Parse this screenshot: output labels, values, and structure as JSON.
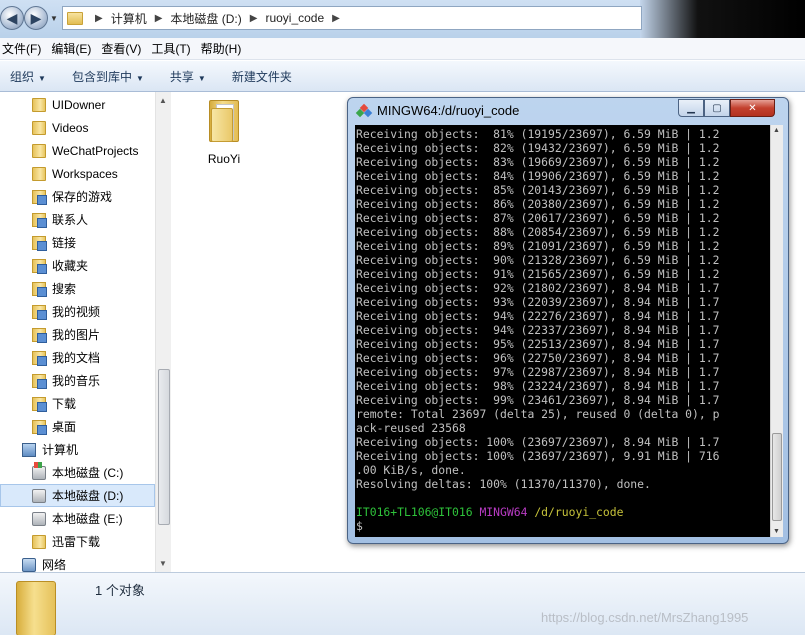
{
  "address": {
    "crumbs": [
      "计算机",
      "本地磁盘 (D:)",
      "ruoyi_code"
    ]
  },
  "menu": [
    "文件(F)",
    "编辑(E)",
    "查看(V)",
    "工具(T)",
    "帮助(H)"
  ],
  "toolbar": {
    "organize": "组织",
    "include_library": "包含到库中",
    "share": "共享",
    "new_folder": "新建文件夹"
  },
  "nav": {
    "uidowner": "UIDowner",
    "videos": "Videos",
    "wechat": "WeChatProjects",
    "workspaces": "Workspaces",
    "saved_games": "保存的游戏",
    "contacts": "联系人",
    "links": "链接",
    "favorites": "收藏夹",
    "searches": "搜索",
    "my_videos": "我的视频",
    "my_pictures": "我的图片",
    "my_documents": "我的文档",
    "my_music": "我的音乐",
    "downloads": "下载",
    "desktop": "桌面",
    "computer": "计算机",
    "drive_c": "本地磁盘 (C:)",
    "drive_d": "本地磁盘 (D:)",
    "drive_e": "本地磁盘 (E:)",
    "thunder": "迅雷下载",
    "network": "网络"
  },
  "content": {
    "folder_name": "RuoYi"
  },
  "status": {
    "count": "1 个对象",
    "watermark": "https://blog.csdn.net/MrsZhang1995"
  },
  "terminal": {
    "title": "MINGW64:/d/ruoyi_code",
    "lines": [
      "Receiving objects:  81% (19195/23697), 6.59 MiB | 1.2",
      "Receiving objects:  82% (19432/23697), 6.59 MiB | 1.2",
      "Receiving objects:  83% (19669/23697), 6.59 MiB | 1.2",
      "Receiving objects:  84% (19906/23697), 6.59 MiB | 1.2",
      "Receiving objects:  85% (20143/23697), 6.59 MiB | 1.2",
      "Receiving objects:  86% (20380/23697), 6.59 MiB | 1.2",
      "Receiving objects:  87% (20617/23697), 6.59 MiB | 1.2",
      "Receiving objects:  88% (20854/23697), 6.59 MiB | 1.2",
      "Receiving objects:  89% (21091/23697), 6.59 MiB | 1.2",
      "Receiving objects:  90% (21328/23697), 6.59 MiB | 1.2",
      "Receiving objects:  91% (21565/23697), 6.59 MiB | 1.2",
      "Receiving objects:  92% (21802/23697), 8.94 MiB | 1.7",
      "Receiving objects:  93% (22039/23697), 8.94 MiB | 1.7",
      "Receiving objects:  94% (22276/23697), 8.94 MiB | 1.7",
      "Receiving objects:  94% (22337/23697), 8.94 MiB | 1.7",
      "Receiving objects:  95% (22513/23697), 8.94 MiB | 1.7",
      "Receiving objects:  96% (22750/23697), 8.94 MiB | 1.7",
      "Receiving objects:  97% (22987/23697), 8.94 MiB | 1.7",
      "Receiving objects:  98% (23224/23697), 8.94 MiB | 1.7",
      "Receiving objects:  99% (23461/23697), 8.94 MiB | 1.7",
      "remote: Total 23697 (delta 25), reused 0 (delta 0), p",
      "ack-reused 23568",
      "Receiving objects: 100% (23697/23697), 8.94 MiB | 1.7",
      "Receiving objects: 100% (23697/23697), 9.91 MiB | 716",
      ".00 KiB/s, done.",
      "Resolving deltas: 100% (11370/11370), done.",
      ""
    ],
    "prompt_user": "IT016+TL106@IT016",
    "prompt_host": "MINGW64",
    "prompt_path": "/d/ruoyi_code",
    "prompt_symbol": "$"
  }
}
